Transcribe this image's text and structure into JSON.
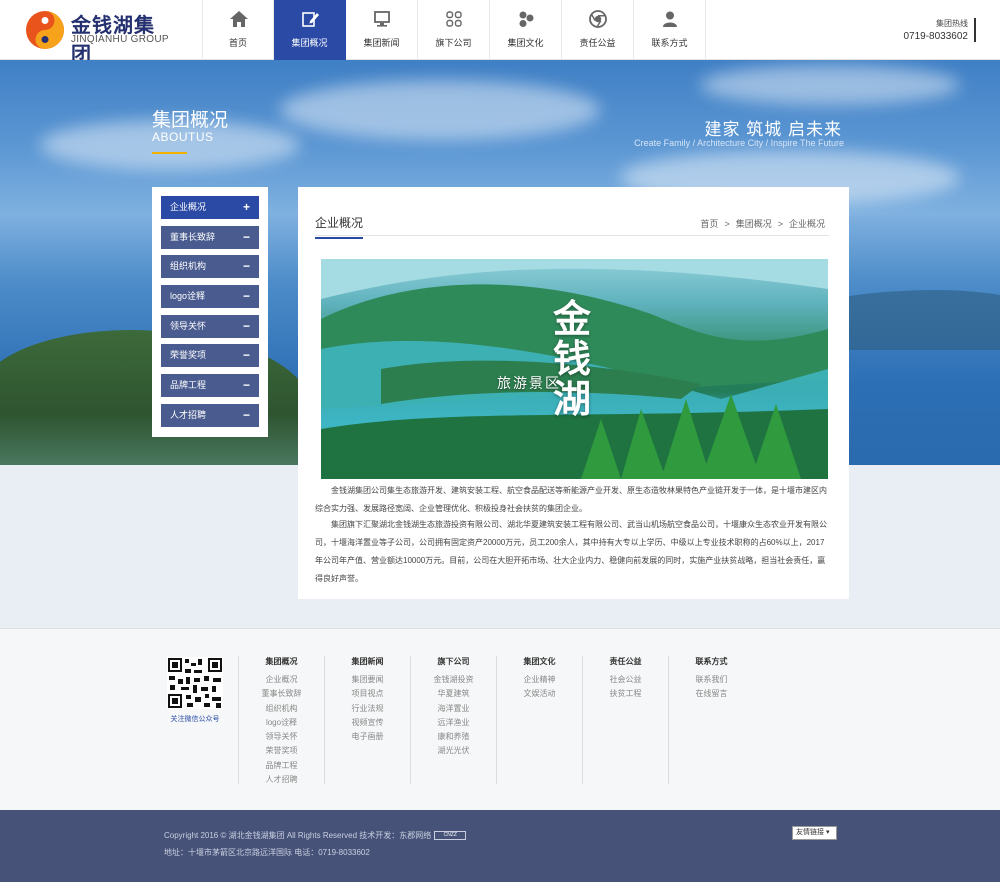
{
  "header": {
    "logo_cn": "金钱湖集团",
    "logo_en": "JINQIANHU GROUP",
    "hotline_label": "集团热线",
    "hotline_number": "0719-8033602",
    "nav": [
      {
        "label": "首页",
        "icon": "home-icon"
      },
      {
        "label": "集团概况",
        "icon": "edit-icon",
        "active": true
      },
      {
        "label": "集团新闻",
        "icon": "monitor-icon"
      },
      {
        "label": "旗下公司",
        "icon": "grid-icon"
      },
      {
        "label": "集团文化",
        "icon": "circles-icon"
      },
      {
        "label": "责任公益",
        "icon": "chrome-icon"
      },
      {
        "label": "联系方式",
        "icon": "user-icon"
      }
    ]
  },
  "banner": {
    "title": "集团概况",
    "subtitle": "ABOUTUS",
    "slogan": "建家 筑城 启未来",
    "slogan_en": "Create Family  /  Architecture City  /  Inspire The Future"
  },
  "sidebar": {
    "items": [
      {
        "label": "企业概况",
        "sign": "+"
      },
      {
        "label": "董事长致辞",
        "sign": "−"
      },
      {
        "label": "组织机构",
        "sign": "−"
      },
      {
        "label": "logo诠释",
        "sign": "−"
      },
      {
        "label": "领导关怀",
        "sign": "−"
      },
      {
        "label": "荣誉奖项",
        "sign": "−"
      },
      {
        "label": "品牌工程",
        "sign": "−"
      },
      {
        "label": "人才招聘",
        "sign": "−"
      }
    ]
  },
  "content": {
    "title": "企业概况",
    "breadcrumb": [
      "首页",
      ">",
      "集团概况",
      ">",
      "企业概况"
    ],
    "photo_text_big": "金钱湖",
    "photo_text_small": "旅游景区",
    "p1": "金钱湖集团公司集生态旅游开发、建筑安装工程、航空食品配送等新能源产业开发、原生态造牧林果特色产业链开发于一体，是十堰市建区内综合实力强、发展路径宽阔、企业管理优化、积极投身社会扶贫的集团企业。",
    "p2": "集团旗下汇聚湖北金钱湖生态旅游投资有限公司、湖北华夏建筑安装工程有限公司、武当山机场航空食品公司，十堰康众生态农业开发有限公司，十堰海洋置业等子公司，公司拥有固定资产20000万元，员工200余人，其中持有大专以上学历、中级以上专业技术职称的占60%以上，2017年公司年产值、营业额达10000万元。目前，公司在大胆开拓市场、壮大企业内力、稳健向前发展的同时，实施产业扶贫战略，担当社会责任，赢得良好声誉。"
  },
  "footer": {
    "qr_label": "关注微信公众号",
    "columns": [
      {
        "title": "集团概况",
        "links": [
          "企业概况",
          "董事长致辞",
          "组织机构",
          "logo诠释",
          "领导关怀",
          "荣誉奖项",
          "品牌工程",
          "人才招聘"
        ]
      },
      {
        "title": "集团新闻",
        "links": [
          "集团要闻",
          "项目视点",
          "行业法规",
          "视频宣传",
          "电子画册"
        ]
      },
      {
        "title": "旗下公司",
        "links": [
          "金钱湖投资",
          "华夏建筑",
          "海洋置业",
          "远洋渔业",
          "康和养殖",
          "湖光光伏"
        ]
      },
      {
        "title": "集团文化",
        "links": [
          "企业精神",
          "文娱活动"
        ]
      },
      {
        "title": "责任公益",
        "links": [
          "社会公益",
          "扶贫工程"
        ]
      },
      {
        "title": "联系方式",
        "links": [
          "联系我们",
          "在线留言"
        ]
      }
    ]
  },
  "copyright": {
    "line1": "Copyright 2016 ©  湖北金钱湖集团    All Rights Reserved    技术开发：东郡网络",
    "cnzz": "CNZZ",
    "line2": "地址：十堰市茅箭区北京路远洋国际    电话：0719-8033602",
    "friend_links": "友情链接 ▾"
  },
  "colors": {
    "primary": "#2b4aa6",
    "sidebar_item": "#4a5c8f",
    "footer_bar": "#465278",
    "accent_line": "#f0b100"
  }
}
